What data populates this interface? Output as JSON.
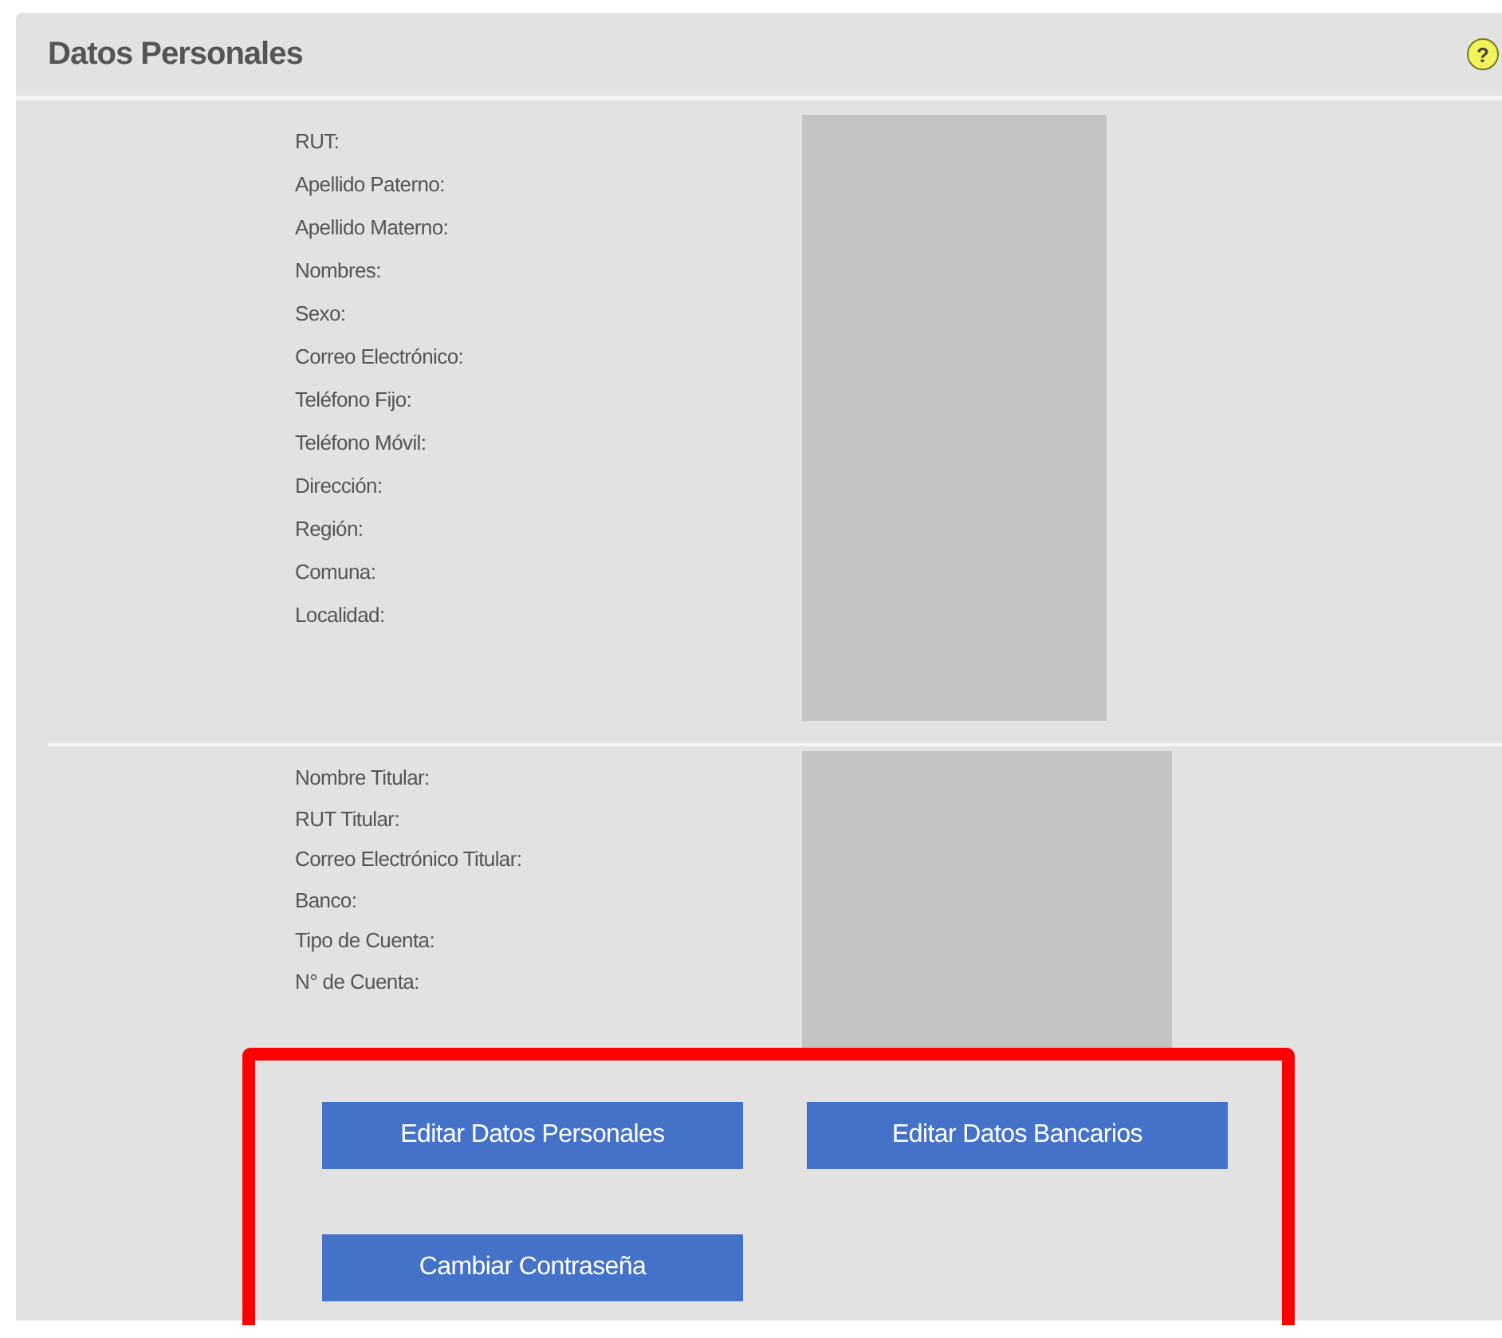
{
  "panel": {
    "title": "Datos Personales",
    "help_icon": "?"
  },
  "sections": [
    {
      "labels": [
        "RUT:",
        "Apellido Paterno:",
        "Apellido Materno:",
        "Nombres:",
        "Sexo:",
        "Correo Electrónico:",
        "Teléfono Fijo:",
        "Teléfono Móvil:",
        "Dirección:",
        "Región:",
        "Comuna:",
        "Localidad:"
      ]
    },
    {
      "labels": [
        "Nombre Titular:",
        "RUT Titular:",
        "Correo Electrónico Titular:",
        "Banco:",
        "Tipo de Cuenta:",
        "N° de Cuenta:"
      ]
    }
  ],
  "buttons": [
    [
      "Editar Datos Personales",
      "Editar Datos Bancarios"
    ],
    [
      "Cambiar Contraseña"
    ]
  ]
}
